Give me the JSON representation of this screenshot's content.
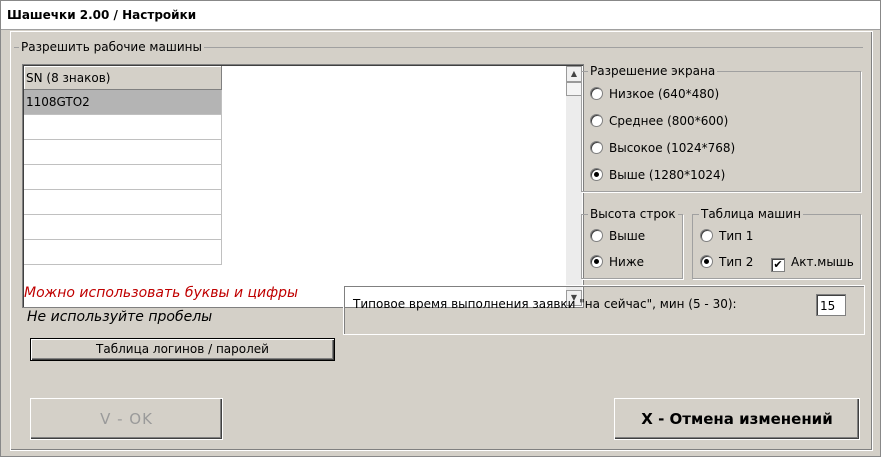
{
  "window": {
    "title": "Шашечки 2.00 / Настройки"
  },
  "allowed_machines": {
    "group_label": "Разрешить рабочие машины",
    "column_header": "SN (8 знаков)",
    "rows": [
      "1108GTO2",
      "",
      "",
      "",
      "",
      "",
      ""
    ],
    "scroll_up_icon": "triangle-up-icon",
    "scroll_down_icon": "triangle-down-icon"
  },
  "screen_resolution": {
    "group_label": "Разрешение экрана",
    "options": [
      "Низкое (640*480)",
      "Среднее (800*600)",
      "Высокое (1024*768)",
      "Выше (1280*1024)"
    ],
    "selected_index": 3
  },
  "row_height": {
    "group_label": "Высота строк",
    "options": [
      "Выше",
      "Ниже"
    ],
    "selected_index": 1
  },
  "machines_table": {
    "group_label": "Таблица машин",
    "options": [
      "Тип 1",
      "Тип 2"
    ],
    "selected_index": 1,
    "checkbox_label": "Акт.мышь",
    "checkbox_checked": true,
    "checkmark": "✔"
  },
  "hints": {
    "letters_digits": "Можно использовать буквы и цифры",
    "no_spaces": "Не используйте пробелы"
  },
  "logins_button": "Таблица логинов / паролей",
  "typical_time": {
    "label": "Типовое время  выполнения  заявки  \"на сейчас\", мин (5 - 30):",
    "value": "15"
  },
  "buttons": {
    "ok": "V   -   OK",
    "cancel": "X  -  Отмена изменений"
  },
  "colors": {
    "hint_red": "#c00000",
    "selected_row": "#b4b4b4",
    "window_bg": "#d4d0c8"
  }
}
